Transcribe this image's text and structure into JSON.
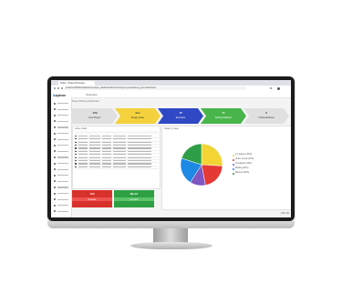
{
  "browser": {
    "tab_title": "Odoo - Project Process",
    "url": "localhost:8069/web#action=project_dashboard&model=project.project&view_type=dashboard"
  },
  "app": {
    "brand_prefix": "A",
    "brand_name": "aptean",
    "page_title": "Overview"
  },
  "sidebar": {
    "items": [
      "Overview",
      "Projects",
      "Tasks",
      "Timesheets",
      "Documents",
      "Reports",
      "Configuration",
      "Settings",
      "Team",
      "Planning",
      "Invoices",
      "Customers",
      "Products",
      "Purchases",
      "Inventory",
      "Quality",
      "Maintenance",
      "Support",
      "Help"
    ]
  },
  "pipeline": {
    "label": "Project Planning Dashboard",
    "stages": [
      {
        "value": "109",
        "label": "New Project",
        "color": "#e0e0e0",
        "text": "#333333"
      },
      {
        "value": "5xx",
        "label": "Design phase",
        "color": "#f4d23d",
        "text": "#333333"
      },
      {
        "value": "72",
        "label": "Execution",
        "color": "#2f49c4",
        "text": "#ffffff"
      },
      {
        "value": "71",
        "label": "Testing/Validation",
        "color": "#48b54a",
        "text": "#ffffff"
      },
      {
        "value": "0",
        "label": "Finished/Closed",
        "color": "#e0e0e0",
        "text": "#333333"
      }
    ]
  },
  "table": {
    "title": "Active Tasks",
    "row_count": 11
  },
  "status": {
    "overdue": {
      "value": "123",
      "label": "Overdue",
      "color": "#d7312b"
    },
    "on_track": {
      "value": "66+10",
      "label": "On track",
      "color": "#2ea043"
    }
  },
  "pie": {
    "title": "Tasks by stage",
    "slices": [
      {
        "label": "In progress (26%)",
        "value": 26,
        "color": "#f2d535"
      },
      {
        "label": "Under review (21%)",
        "value": 21,
        "color": "#e53935"
      },
      {
        "label": "Completed (12%)",
        "value": 12,
        "color": "#7e57c2"
      },
      {
        "label": "Waiting (21%)",
        "value": 21,
        "color": "#1e88e5"
      },
      {
        "label": "Planned (20%)",
        "value": 20,
        "color": "#2e9e48"
      }
    ]
  },
  "footer": {
    "pager": "1-80 / 80"
  }
}
